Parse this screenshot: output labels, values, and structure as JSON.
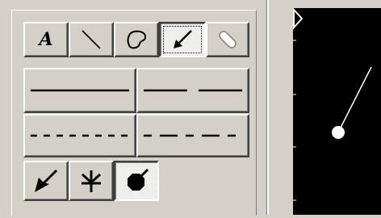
{
  "toolbar": {
    "text_tool_label": "A",
    "tools": [
      {
        "name": "text-tool",
        "icon": "text-A-icon"
      },
      {
        "name": "line-tool",
        "icon": "diagonal-line-icon"
      },
      {
        "name": "freehand-tool",
        "icon": "lasso-shape-icon"
      },
      {
        "name": "arrow-tool",
        "icon": "arrow-down-left-icon",
        "selected": true
      },
      {
        "name": "eraser-tool",
        "icon": "eraser-icon"
      }
    ],
    "line_styles": [
      "solid",
      "long-dash",
      "short-dash",
      "dash-dot"
    ],
    "arrowheads": [
      {
        "name": "filled-arrowhead",
        "icon": "arrowhead-icon"
      },
      {
        "name": "open-arrowhead",
        "icon": "barb-arrowhead-icon"
      },
      {
        "name": "dot-arrowhead",
        "icon": "octagon-dot-icon",
        "selected": true
      }
    ]
  },
  "colors": {
    "panel_bg": "#d4d0c8",
    "viewer_bg": "#000000",
    "annotation": "#ffffff"
  }
}
